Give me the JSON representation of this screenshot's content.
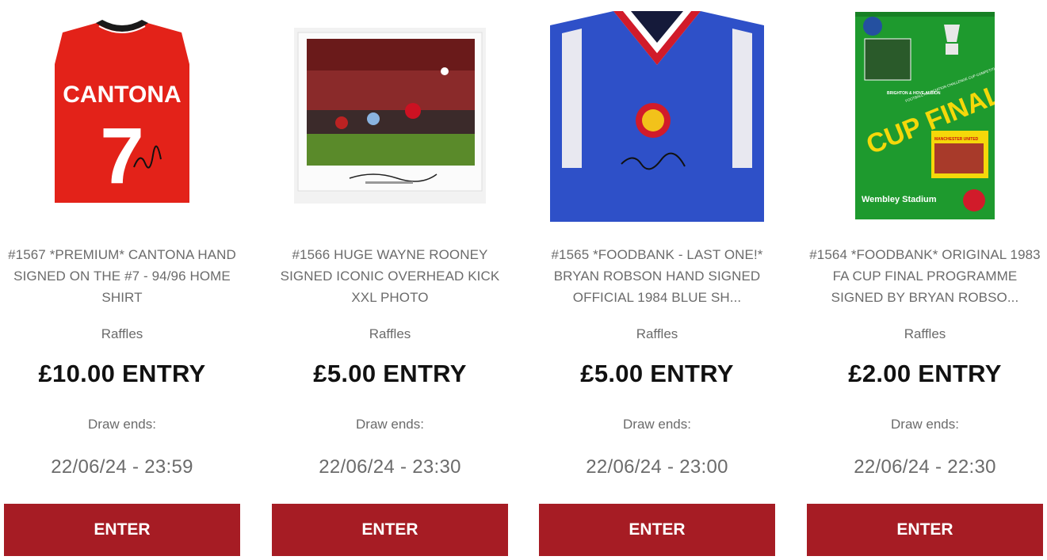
{
  "colors": {
    "button": "#a61c24",
    "button_text": "#ffffff",
    "price_text": "#111111",
    "meta_text": "#6b6b6b"
  },
  "listings": [
    {
      "image": "cantona-signed-shirt-image",
      "title": "#1567 *PREMIUM* CANTONA HAND SIGNED ON THE #7 - 94/96 HOME SHIRT",
      "category": "Raffles",
      "price": "£10.00 ENTRY",
      "draw_label": "Draw ends:",
      "draw_date": "22/06/24 - 23:59",
      "button": "ENTER",
      "shirt_name": "CANTONA",
      "shirt_number": "7"
    },
    {
      "image": "rooney-overhead-kick-photo-image",
      "title": "#1566 HUGE WAYNE ROONEY SIGNED ICONIC OVERHEAD KICK XXL PHOTO",
      "category": "Raffles",
      "price": "£5.00 ENTRY",
      "draw_label": "Draw ends:",
      "draw_date": "22/06/24 - 23:30",
      "button": "ENTER"
    },
    {
      "image": "robson-blue-shirt-image",
      "title": "#1565 *FOODBANK - LAST ONE!* BRYAN ROBSON HAND SIGNED OFFICIAL 1984 BLUE SH...",
      "category": "Raffles",
      "price": "£5.00 ENTRY",
      "draw_label": "Draw ends:",
      "draw_date": "22/06/24 - 23:00",
      "button": "ENTER"
    },
    {
      "image": "cup-final-programme-image",
      "title": "#1564 *FOODBANK* ORIGINAL 1983 FA CUP FINAL PROGRAMME SIGNED BY BRYAN ROBSO...",
      "category": "Raffles",
      "price": "£2.00 ENTRY",
      "draw_label": "Draw ends:",
      "draw_date": "22/06/24 - 22:30",
      "button": "ENTER",
      "programme_title": "CUP FINAL",
      "programme_subtitle": "FOOTBALL ASSOCIATION CHALLENGE CUP COMPETITION",
      "programme_team1": "BRIGHTON & HOVE ALBION",
      "programme_team2": "MANCHESTER UNITED",
      "programme_venue": "Wembley Stadium"
    }
  ]
}
